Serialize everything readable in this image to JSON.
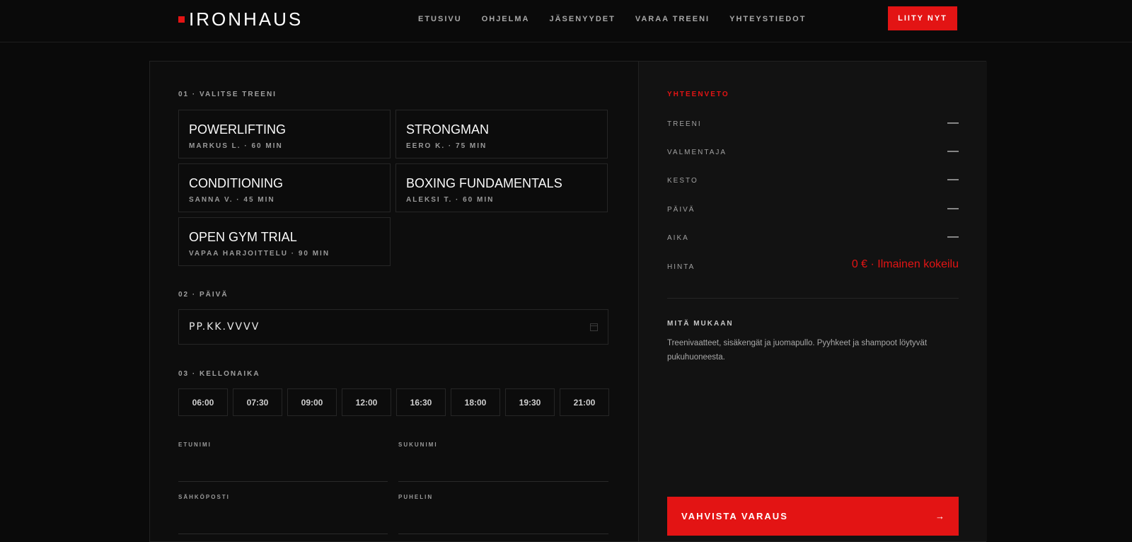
{
  "brand": {
    "name": "IRONHAUS",
    "accent": "#e31414"
  },
  "nav": {
    "items": [
      "ETUSIVU",
      "OHJELMA",
      "JÄSENYYDET",
      "VARAA TREENI",
      "YHTEYSTIEDOT"
    ],
    "cta": "LIITY NYT"
  },
  "step1": {
    "label": "01 · VALITSE TREENI",
    "cards": [
      {
        "title": "POWERLIFTING",
        "sub": "MARKUS L. · 60 MIN"
      },
      {
        "title": "STRONGMAN",
        "sub": "EERO K. · 75 MIN"
      },
      {
        "title": "CONDITIONING",
        "sub": "SANNA V. · 45 MIN"
      },
      {
        "title": "BOXING FUNDAMENTALS",
        "sub": "ALEKSI T. · 60 MIN"
      },
      {
        "title": "OPEN GYM TRIAL",
        "sub": "VAPAA HARJOITTELU · 90 MIN"
      }
    ]
  },
  "step2": {
    "label": "02 · PÄIVÄ",
    "placeholder": "PP.KK.VVVV"
  },
  "step3": {
    "label": "03 · KELLONAIKA",
    "times": [
      "06:00",
      "07:30",
      "09:00",
      "12:00",
      "16:30",
      "18:00",
      "19:30",
      "21:00"
    ]
  },
  "form": {
    "first_name": "ETUNIMI",
    "last_name": "SUKUNIMI",
    "email": "SÄHKÖPOSTI",
    "phone": "PUHELIN"
  },
  "summary": {
    "title": "YHTEENVETO",
    "rows": [
      {
        "key": "TREENI",
        "value": "—"
      },
      {
        "key": "VALMENTAJA",
        "value": "—"
      },
      {
        "key": "KESTO",
        "value": "—"
      },
      {
        "key": "PÄIVÄ",
        "value": "—"
      },
      {
        "key": "AIKA",
        "value": "—"
      },
      {
        "key": "HINTA",
        "value": "0 € · Ilmainen kokeilu"
      }
    ],
    "bring_title": "MITÄ MUKAAN",
    "bring_text": "Treenivaatteet, sisäkengät ja juomapullo. Pyyhkeet ja shampoot löytyvät pukuhuoneesta.",
    "confirm": "VAHVISTA VARAUS",
    "confirm_icon": "arrow-right-icon"
  }
}
